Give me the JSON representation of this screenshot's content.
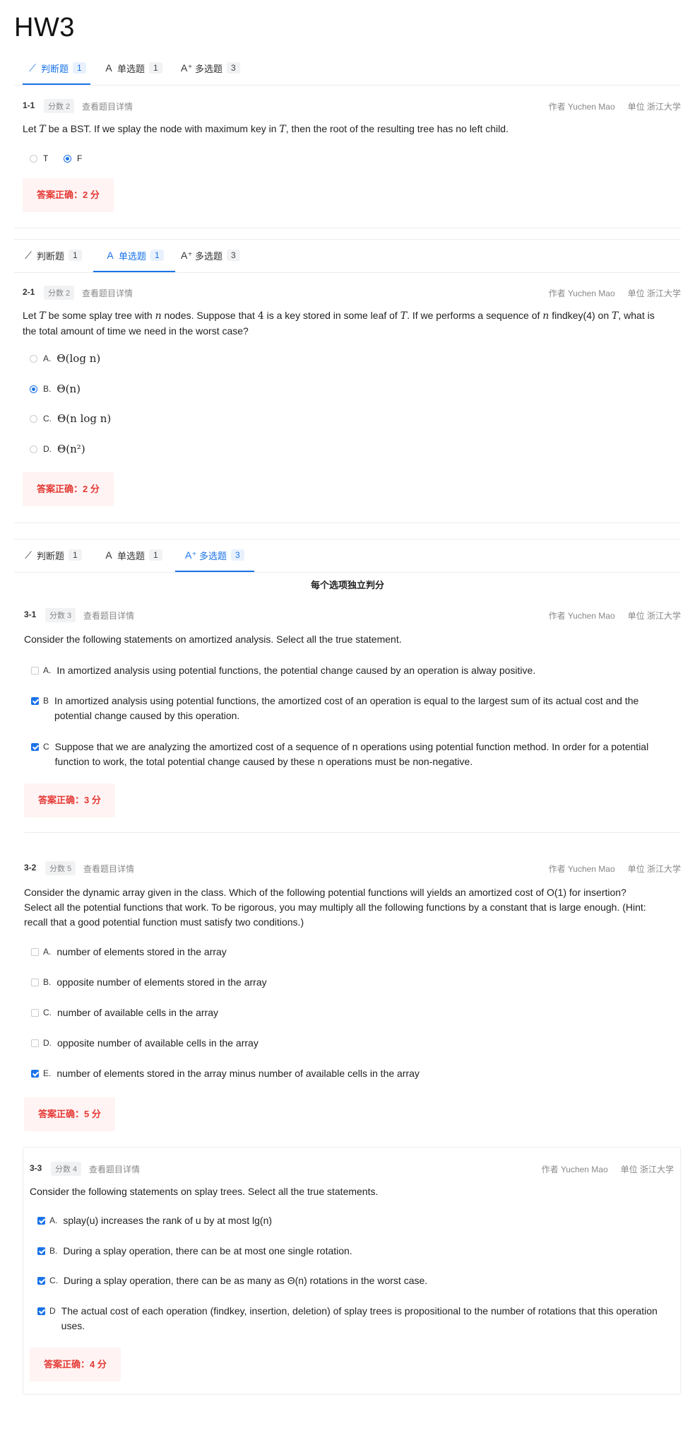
{
  "page_title": "HW3",
  "tabs": [
    {
      "label": "判断题",
      "count": "1",
      "icon": "judge-icon"
    },
    {
      "label": "单选题",
      "count": "1",
      "icon": "single-choice-icon"
    },
    {
      "label": "多选题",
      "count": "3",
      "icon": "multi-choice-icon"
    }
  ],
  "common": {
    "score_prefix": "分数",
    "detail_link": "查看题目详情",
    "author_label": "作者 Yuchen Mao",
    "unit_label": "单位 浙江大学",
    "independent_note": "每个选项独立判分"
  },
  "colors": {
    "accent": "#1a73e8",
    "result_bg": "#fff4f3",
    "result_text": "#e53935"
  },
  "q1_1": {
    "num": "1-1",
    "score": "分数 2",
    "text_a": "Let ",
    "var_t": "T",
    "text_b": " be a BST. If we splay the node with maximum key in ",
    "var_t2": "T",
    "text_c": ", then the root of the resulting tree has no left child.",
    "options": [
      {
        "label": "T",
        "selected": false
      },
      {
        "label": "F",
        "selected": true
      }
    ],
    "result": "答案正确：2 分"
  },
  "q2_1": {
    "num": "2-1",
    "score": "分数 2",
    "line1_a": "Let ",
    "line1_t": "T",
    "line1_b": " be some splay tree with ",
    "line1_n": "n",
    "line1_c": " nodes. Suppose that ",
    "line1_4": "4",
    "line1_d": " is a key stored in some leaf of ",
    "line1_t2": "T",
    "line1_e": ". If we performs a sequence of ",
    "line1_n2": "n",
    "line1_f": " findkey(4) on ",
    "line1_t3": "T",
    "line1_g": ", what is",
    "line2": "the total amount of time we need in the worst case?",
    "options": [
      {
        "label": "A.",
        "text": "Θ(log n)",
        "selected": false
      },
      {
        "label": "B.",
        "text": "Θ(n)",
        "selected": true
      },
      {
        "label": "C.",
        "text": "Θ(n log n)",
        "selected": false
      },
      {
        "label": "D.",
        "text": "Θ(n²)",
        "selected": false
      }
    ],
    "result": "答案正确：2 分"
  },
  "q3_1": {
    "num": "3-1",
    "score": "分数 3",
    "text": "Consider the following statements on amortized analysis. Select all the true statement.",
    "options": [
      {
        "label": "A.",
        "text": "In amortized analysis using potential functions, the potential change caused by an operation is alway positive.",
        "checked": false
      },
      {
        "label": "B",
        "text": "In amortized analysis using potential functions, the amortized cost of an operation is equal to the largest sum of its actual cost and the potential change caused by this operation.",
        "checked": true
      },
      {
        "label": "C",
        "text": "Suppose that we are analyzing the amortized cost of a sequence of n operations using potential function method. In order for a potential function to work, the total potential change caused by these n operations must be non-negative.",
        "checked": true
      }
    ],
    "result": "答案正确：3 分"
  },
  "q3_2": {
    "num": "3-2",
    "score": "分数 5",
    "line1": "Consider the dynamic array given in the class. Which of the following potential functions will yields an amortized cost of O(1) for insertion?",
    "line2": "Select all the potential functions that work. To be rigorous, you may multiply all the following functions by a constant that is large enough. (Hint:",
    "line3": "recall that a good potential function must satisfy two conditions.)",
    "options": [
      {
        "label": "A.",
        "text": "number of elements stored in the array",
        "checked": false
      },
      {
        "label": "B.",
        "text": "opposite number of elements stored in the array",
        "checked": false
      },
      {
        "label": "C.",
        "text": "number of available cells in the array",
        "checked": false
      },
      {
        "label": "D.",
        "text": "opposite number of available cells in the array",
        "checked": false
      },
      {
        "label": "E.",
        "text": "number of elements stored in the array minus number of available cells in the array",
        "checked": true
      }
    ],
    "result": "答案正确：5 分"
  },
  "q3_3": {
    "num": "3-3",
    "score": "分数 4",
    "text": "Consider the following statements on splay trees. Select all the true statements.",
    "options": [
      {
        "label": "A.",
        "text": "splay(u) increases the rank of u by at most lg(n)",
        "checked": true
      },
      {
        "label": "B.",
        "text": "During a splay operation, there can be at most one single rotation.",
        "checked": true
      },
      {
        "label": "C.",
        "text": "During a splay operation, there can be as many as Θ(n) rotations in the worst case.",
        "checked": true
      },
      {
        "label": "D",
        "text": "The actual cost of each operation (findkey, insertion, deletion) of splay trees is propositional to the number of rotations that this operation uses.",
        "checked": true
      }
    ],
    "result": "答案正确：4 分"
  }
}
